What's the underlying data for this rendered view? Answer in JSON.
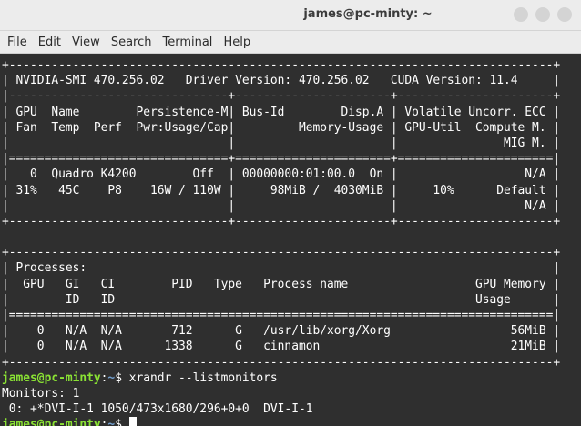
{
  "window": {
    "title": "james@pc-minty: ~",
    "controls": [
      {
        "name": "minimize",
        "color": "#d4d4d4"
      },
      {
        "name": "maximize",
        "color": "#d4d4d4"
      },
      {
        "name": "close",
        "color": "#d4d4d4"
      }
    ]
  },
  "menubar": {
    "items": [
      "File",
      "Edit",
      "View",
      "Search",
      "Terminal",
      "Help"
    ]
  },
  "terminal": {
    "smi_lines": [
      "+-----------------------------------------------------------------------------+",
      "| NVIDIA-SMI 470.256.02   Driver Version: 470.256.02   CUDA Version: 11.4     |",
      "|-------------------------------+----------------------+----------------------+",
      "| GPU  Name        Persistence-M| Bus-Id        Disp.A | Volatile Uncorr. ECC |",
      "| Fan  Temp  Perf  Pwr:Usage/Cap|         Memory-Usage | GPU-Util  Compute M. |",
      "|                               |                      |               MIG M. |",
      "|===============================+======================+======================|",
      "|   0  Quadro K4200        Off  | 00000000:01:00.0  On |                  N/A |",
      "| 31%   45C    P8    16W / 110W |     98MiB /  4030MiB |     10%      Default |",
      "|                               |                      |                  N/A |",
      "+-------------------------------+----------------------+----------------------+",
      "",
      "+-----------------------------------------------------------------------------+",
      "| Processes:                                                                  |",
      "|  GPU   GI   CI        PID   Type   Process name                  GPU Memory |",
      "|        ID   ID                                                   Usage      |",
      "|=============================================================================|",
      "|    0   N/A  N/A       712      G   /usr/lib/xorg/Xorg                 56MiB |",
      "|    0   N/A  N/A      1338      G   cinnamon                           21MiB |",
      "+-----------------------------------------------------------------------------+"
    ],
    "prompt_user": "james@pc-minty",
    "prompt_sep": ":",
    "prompt_path": "~",
    "prompt_symbol": "$ ",
    "command": "xrandr --listmonitors",
    "output_lines": [
      "Monitors: 1",
      " 0: +*DVI-I-1 1050/473x1680/296+0+0  DVI-I-1"
    ]
  },
  "colors": {
    "background": "#2f2f2f",
    "foreground": "#ffffff",
    "prompt_user": "#8ae234",
    "prompt_path": "#729fcf"
  }
}
